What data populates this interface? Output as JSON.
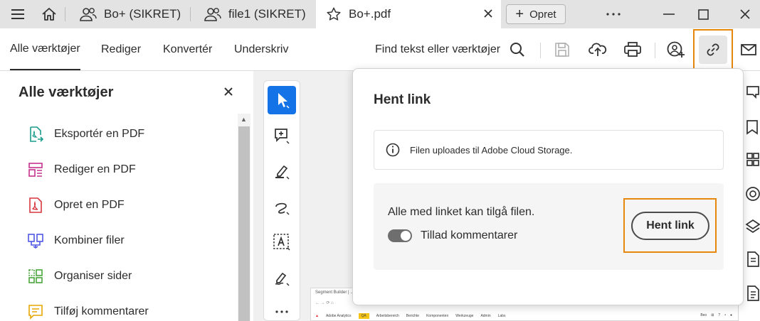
{
  "tabbar": {
    "tabs": [
      {
        "label": "Bo+ (SIKRET)",
        "icon": "shared-users-icon"
      },
      {
        "label": "file1 (SIKRET)",
        "icon": "shared-users-icon"
      },
      {
        "label": "Bo+.pdf",
        "icon": "star-icon",
        "active": true
      }
    ],
    "new_tab_label": "Opret"
  },
  "toolbar": {
    "tabs": [
      "Alle værktøjer",
      "Rediger",
      "Konvertér",
      "Underskriv"
    ],
    "active_tab": "Alle værktøjer",
    "find_text": "Find tekst eller værktøjer"
  },
  "left_panel": {
    "title": "Alle værktøjer",
    "items": [
      {
        "label": "Eksportér en PDF",
        "icon": "export-pdf-icon",
        "color": "#1a9c8c"
      },
      {
        "label": "Rediger en PDF",
        "icon": "edit-pdf-icon",
        "color": "#c4328e"
      },
      {
        "label": "Opret en PDF",
        "icon": "create-pdf-icon",
        "color": "#d7373f"
      },
      {
        "label": "Kombiner filer",
        "icon": "combine-files-icon",
        "color": "#5258e4"
      },
      {
        "label": "Organiser sider",
        "icon": "organize-pages-icon",
        "color": "#4ba63c"
      },
      {
        "label": "Tilføj kommentarer",
        "icon": "add-comment-icon",
        "color": "#e6a700"
      }
    ]
  },
  "popover": {
    "title": "Hent link",
    "info_text": "Filen uploades til Adobe Cloud Storage.",
    "share_text": "Alle med linket kan tilgå filen.",
    "toggle_label": "Tillad kommentarer",
    "toggle_on": true,
    "button_label": "Hent link"
  },
  "document": {
    "line1": "Segment Builder | ...",
    "nav": [
      "Adobe Analytics",
      "QA",
      "Arbeitsbereich",
      "Berichte",
      "Komponenten",
      "Werkzeuge",
      "Admin",
      "Labs"
    ],
    "user": "Beo"
  },
  "colors": {
    "accent": "#1473e6",
    "highlight": "#e8870d"
  }
}
